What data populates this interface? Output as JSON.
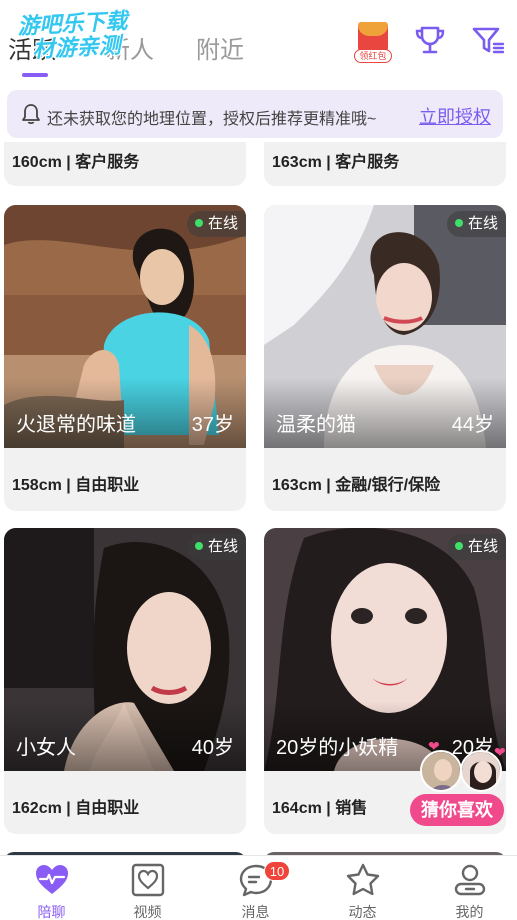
{
  "topbar": {
    "tabs": [
      {
        "label": "活跃"
      },
      {
        "label": "新人"
      },
      {
        "label": "附近"
      }
    ],
    "watermark": {
      "line1": "游吧乐下载",
      "line2": "材游亲测"
    },
    "redpack_label": "领红包",
    "icons": [
      "red-envelope-icon",
      "trophy-icon",
      "filter-icon"
    ],
    "accent_color": "#8a5cf6"
  },
  "location_banner": {
    "text": "还未获取您的地理位置，授权后推荐更精准哦~",
    "action": "立即授权"
  },
  "partial_cards": [
    {
      "info": "160cm | 客户服务"
    },
    {
      "info": "163cm | 客户服务"
    }
  ],
  "cards": [
    {
      "status": "在线",
      "nickname": "火退常的味道",
      "age": "37岁",
      "info": "158cm | 自由职业"
    },
    {
      "status": "在线",
      "nickname": "温柔的猫",
      "age": "44岁",
      "info": "163cm | 金融/银行/保险"
    },
    {
      "status": "在线",
      "nickname": "小女人",
      "age": "40岁",
      "info": "162cm | 自由职业"
    },
    {
      "status": "在线",
      "nickname": "20岁的小妖精",
      "age": "20岁",
      "info": "164cm | 销售"
    }
  ],
  "guess_like": {
    "label": "猜你喜欢"
  },
  "bottom_nav": [
    {
      "label": "陪聊",
      "icon": "heartbeat-icon",
      "active": true
    },
    {
      "label": "视频",
      "icon": "video-heart-icon"
    },
    {
      "label": "消息",
      "icon": "chat-bubble-icon",
      "badge": "10"
    },
    {
      "label": "动态",
      "icon": "star-icon"
    },
    {
      "label": "我的",
      "icon": "profile-icon"
    }
  ]
}
